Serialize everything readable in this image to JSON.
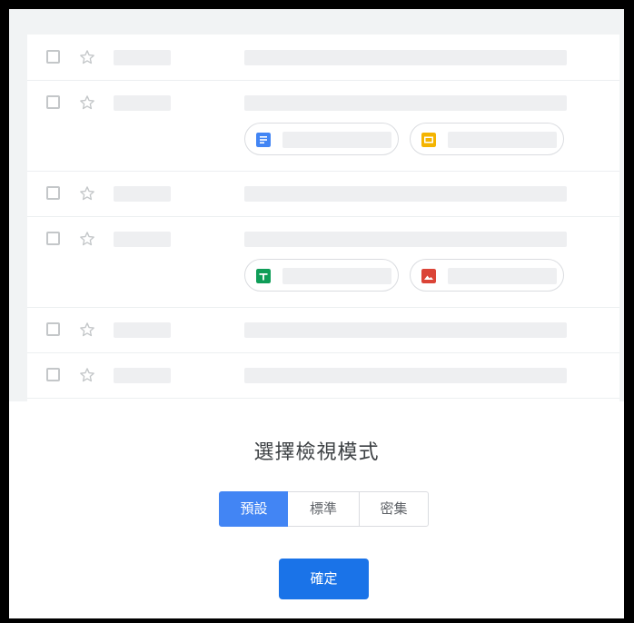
{
  "dialog": {
    "title": "選擇檢視模式",
    "options": [
      {
        "label": "預設",
        "selected": true
      },
      {
        "label": "標準",
        "selected": false
      },
      {
        "label": "密集",
        "selected": false
      }
    ],
    "confirm_label": "確定"
  },
  "preview": {
    "attachment_icons": [
      "docs-icon",
      "slides-icon",
      "sheets-icon",
      "image-file-icon"
    ]
  },
  "colors": {
    "accent": "#1a73e8",
    "selected_option": "#4285f4",
    "docs": "#4285f4",
    "slides": "#f4b400",
    "sheets": "#0f9d58",
    "image": "#db4437"
  }
}
